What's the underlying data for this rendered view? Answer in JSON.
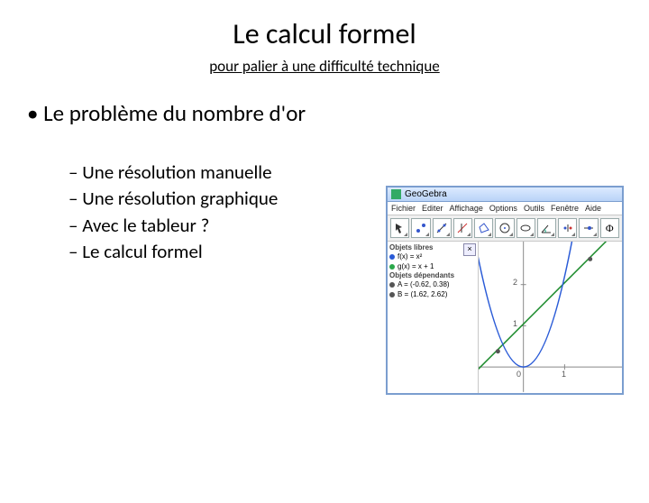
{
  "title": "Le calcul formel",
  "subtitle": "pour palier à une difficulté technique",
  "main_bullet": "Le problème du nombre d'or",
  "sub_bullets": [
    "Une résolution manuelle",
    "Une résolution graphique",
    "Avec le tableur ?",
    "Le calcul formel"
  ],
  "geogebra": {
    "app_name": "GeoGebra",
    "menu": [
      "Fichier",
      "Editer",
      "Affichage",
      "Options",
      "Outils",
      "Fenêtre",
      "Aide"
    ],
    "toolbar_last_label": "Φ",
    "side": {
      "free_header": "Objets libres",
      "free_items": [
        "f(x) = x²",
        "g(x) = x + 1"
      ],
      "dep_header": "Objets dépendants",
      "dep_items": [
        "A = (-0.62, 0.38)",
        "B = (1.62, 2.62)"
      ]
    },
    "axis_labels": {
      "y2": "2",
      "y1": "1",
      "x0": "0",
      "x1": "1"
    }
  }
}
